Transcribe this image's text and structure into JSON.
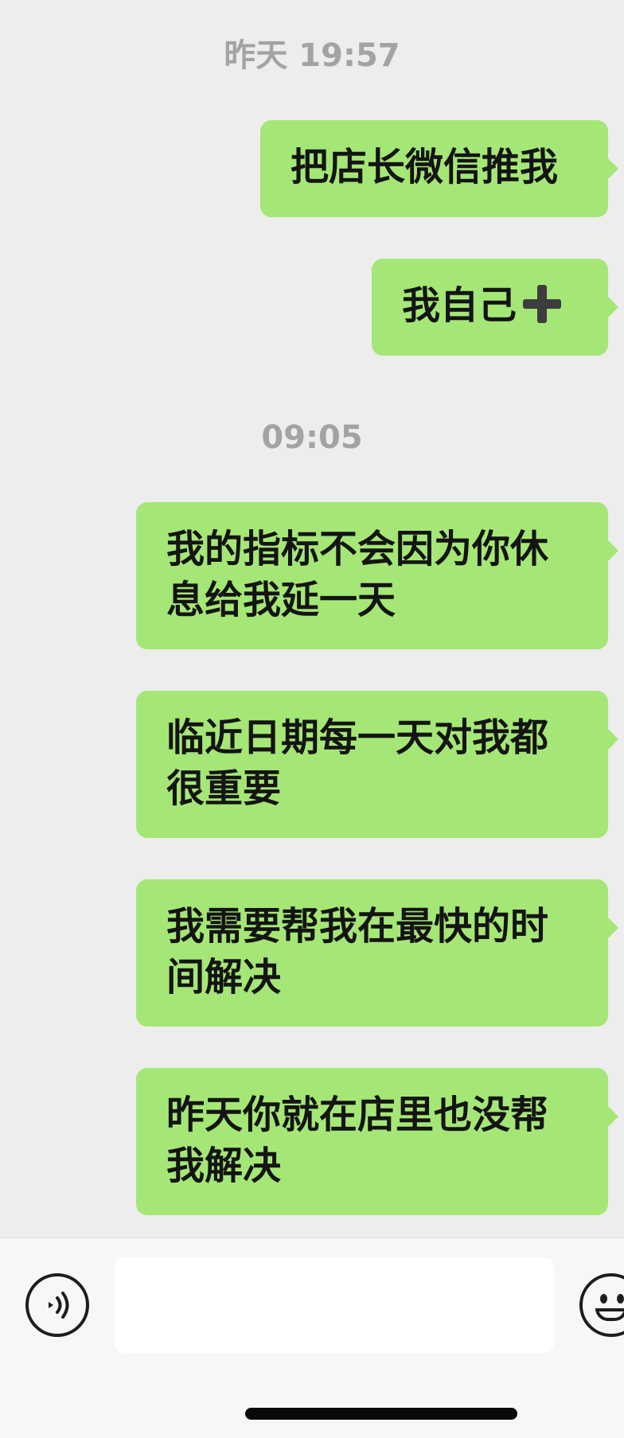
{
  "chat": {
    "timestamps": [
      "昨天 19:57",
      "09:05"
    ],
    "messages": [
      {
        "text": "把店长微信推我",
        "sender": "me"
      },
      {
        "text": "我自己",
        "sender": "me",
        "trailing_icon": "plus-icon"
      },
      {
        "text": "我的指标不会因为你休息给我延一天",
        "sender": "me"
      },
      {
        "text": "临近日期每一天对我都很重要",
        "sender": "me"
      },
      {
        "text": "我需要帮我在最快的时间解决",
        "sender": "me"
      },
      {
        "text": "昨天你就在店里也没帮我解决",
        "sender": "me"
      }
    ]
  },
  "input_bar": {
    "placeholder": "",
    "voice_icon": "voice-icon",
    "emoji_icon": "emoji-icon"
  },
  "colors": {
    "background": "#ededed",
    "outgoing_bubble": "#a5e776",
    "timestamp_text": "#a3a3a3"
  }
}
